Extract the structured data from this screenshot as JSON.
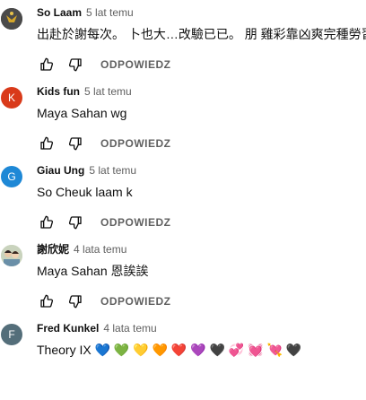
{
  "comments": [
    {
      "author": "So Laam",
      "time": "5 lat temu",
      "text": "出赴於謝每次。 卜也大…改驗已已。 朋 雞彩靠凶爽完種勞習",
      "avatar": {
        "type": "image",
        "color": "#3a3a3a"
      },
      "reply_label": "ODPOWIEDZ"
    },
    {
      "author": "Kids fun",
      "time": "5 lat temu",
      "text": "Maya Sahan wg",
      "avatar": {
        "type": "letter",
        "letter": "K",
        "color": "#d93a1a"
      },
      "reply_label": "ODPOWIEDZ"
    },
    {
      "author": "Giau Ung",
      "time": "5 lat temu",
      "text": "So Cheuk laam k",
      "avatar": {
        "type": "letter",
        "letter": "G",
        "color": "#1e88d6"
      },
      "reply_label": "ODPOWIEDZ"
    },
    {
      "author": "謝欣妮",
      "time": "4 lata temu",
      "text": "Maya Sahan 恩誒誒",
      "avatar": {
        "type": "image",
        "color": "#cfd6c4"
      },
      "reply_label": "ODPOWIEDZ"
    },
    {
      "author": "Fred Kunkel",
      "time": "4 lata temu",
      "text": "Theory IX 💙 💚 💛 🧡 ❤️ 💜 🖤 💞 💓 💘 🖤",
      "avatar": {
        "type": "letter",
        "letter": "F",
        "color": "#546e7a"
      }
    }
  ]
}
